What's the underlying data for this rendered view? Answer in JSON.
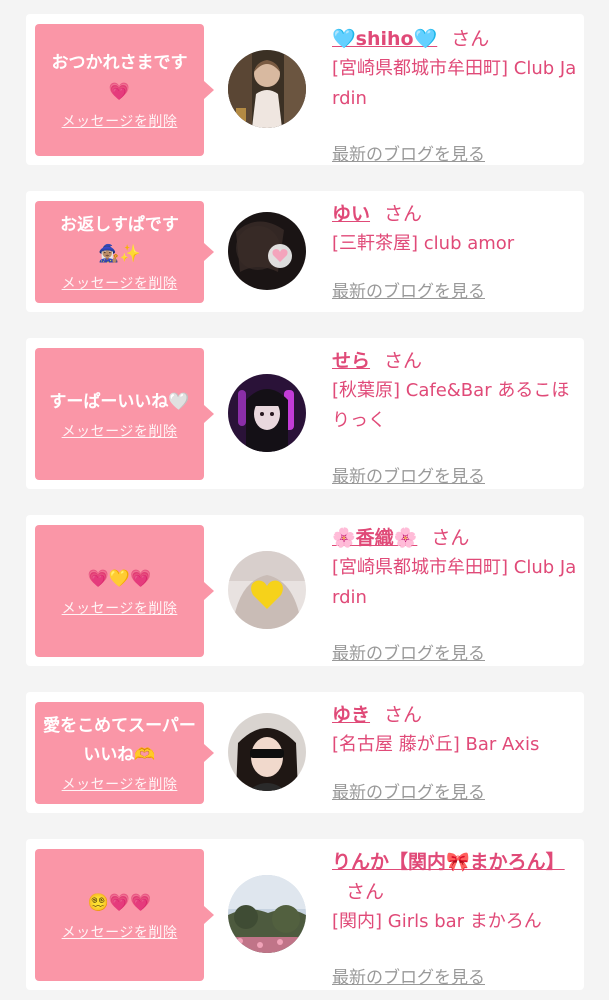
{
  "colors": {
    "accent": "#e04a78",
    "bubble": "#fa96a7",
    "background": "#f4f4f4",
    "card": "#ffffff",
    "link_gray": "#999999"
  },
  "labels": {
    "delete": "メッセージを削除",
    "blog": "最新のブログを見る",
    "honorific": "さん"
  },
  "cards": [
    {
      "message": "おつかれさまです💗",
      "name": "🩵shiho🩵",
      "shop": "[宮崎県都城市牟田町] Club Jardin",
      "avatar_icon": "woman-in-white-dress-photo"
    },
    {
      "message": "お返しすぱです🧙🏽‍♀️✨",
      "name": "ゆい",
      "shop": "[三軒茶屋] club amor",
      "avatar_icon": "dark-photo-with-heart-sticker"
    },
    {
      "message": "すーぱーいいね🤍",
      "name": "せら",
      "shop": "[秋葉原] Cafe&Bar あるこほりっく",
      "avatar_icon": "black-hair-girl-purple-light-photo"
    },
    {
      "message": "💗💛💗",
      "name": "🌸香織🌸",
      "shop": "[宮崎県都城市牟田町] Club Jardin",
      "avatar_icon": "yellow-heart-sticker-photo"
    },
    {
      "message": "愛をこめてスーパーいいね🫶",
      "name": "ゆき",
      "shop": "[名古屋 藤が丘] Bar Axis",
      "avatar_icon": "girl-with-sunglasses-photo"
    },
    {
      "message": "😵‍💫💗💗",
      "name": "りんか【関内🎀まかろん】",
      "shop": "[関内] Girls bar まかろん",
      "avatar_icon": "garden-sky-photo"
    }
  ]
}
